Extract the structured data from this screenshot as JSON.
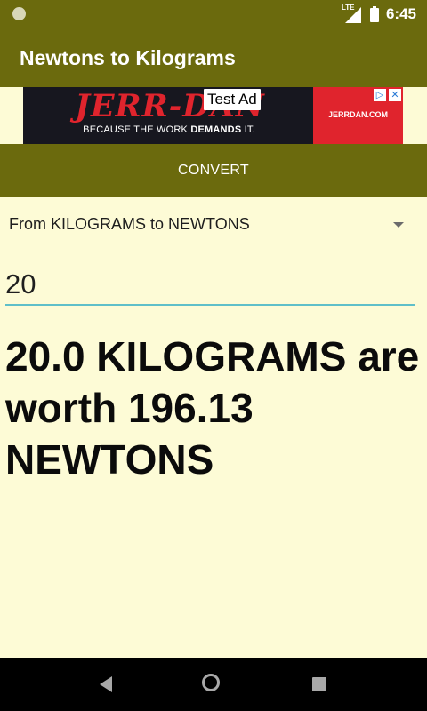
{
  "status_bar": {
    "network_label": "LTE",
    "time": "6:45"
  },
  "app_bar": {
    "title": "Newtons to Kilograms"
  },
  "ad": {
    "badge": "Test Ad",
    "logo_text": "JERR-DAN",
    "tagline_prefix": "BECAUSE THE WORK ",
    "tagline_bold": "DEMANDS",
    "tagline_suffix": " IT.",
    "url": "JERRDAN.COM",
    "choices_icon": "ad-choices-icon",
    "close_icon": "close-icon"
  },
  "convert_button": {
    "label": "CONVERT"
  },
  "spinner": {
    "selected": "From KILOGRAMS to NEWTONS"
  },
  "input": {
    "value": "20"
  },
  "result": {
    "text": "20.0 KILOGRAMS are worth 196.13 NEWTONS"
  },
  "colors": {
    "toolbar": "#6b6a0d",
    "background": "#fdfbd6",
    "accent": "#5fbfc9",
    "ad_red": "#e0242d"
  },
  "nav_bar": {
    "back_icon": "back-icon",
    "home_icon": "home-icon",
    "recents_icon": "recents-icon"
  }
}
